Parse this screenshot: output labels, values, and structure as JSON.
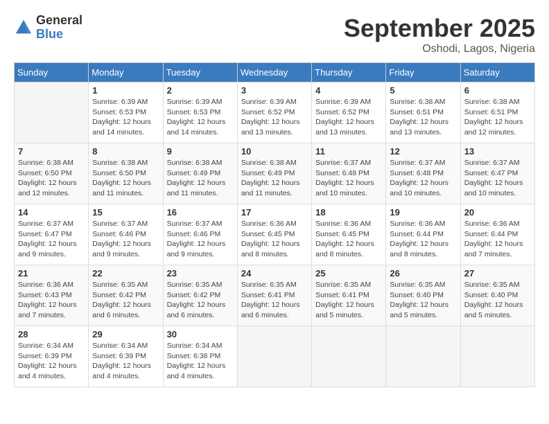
{
  "logo": {
    "general": "General",
    "blue": "Blue"
  },
  "title": "September 2025",
  "location": "Oshodi, Lagos, Nigeria",
  "days_of_week": [
    "Sunday",
    "Monday",
    "Tuesday",
    "Wednesday",
    "Thursday",
    "Friday",
    "Saturday"
  ],
  "weeks": [
    [
      {
        "day": "",
        "info": ""
      },
      {
        "day": "1",
        "info": "Sunrise: 6:39 AM\nSunset: 6:53 PM\nDaylight: 12 hours\nand 14 minutes."
      },
      {
        "day": "2",
        "info": "Sunrise: 6:39 AM\nSunset: 6:53 PM\nDaylight: 12 hours\nand 14 minutes."
      },
      {
        "day": "3",
        "info": "Sunrise: 6:39 AM\nSunset: 6:52 PM\nDaylight: 12 hours\nand 13 minutes."
      },
      {
        "day": "4",
        "info": "Sunrise: 6:39 AM\nSunset: 6:52 PM\nDaylight: 12 hours\nand 13 minutes."
      },
      {
        "day": "5",
        "info": "Sunrise: 6:38 AM\nSunset: 6:51 PM\nDaylight: 12 hours\nand 13 minutes."
      },
      {
        "day": "6",
        "info": "Sunrise: 6:38 AM\nSunset: 6:51 PM\nDaylight: 12 hours\nand 12 minutes."
      }
    ],
    [
      {
        "day": "7",
        "info": "Sunrise: 6:38 AM\nSunset: 6:50 PM\nDaylight: 12 hours\nand 12 minutes."
      },
      {
        "day": "8",
        "info": "Sunrise: 6:38 AM\nSunset: 6:50 PM\nDaylight: 12 hours\nand 11 minutes."
      },
      {
        "day": "9",
        "info": "Sunrise: 6:38 AM\nSunset: 6:49 PM\nDaylight: 12 hours\nand 11 minutes."
      },
      {
        "day": "10",
        "info": "Sunrise: 6:38 AM\nSunset: 6:49 PM\nDaylight: 12 hours\nand 11 minutes."
      },
      {
        "day": "11",
        "info": "Sunrise: 6:37 AM\nSunset: 6:48 PM\nDaylight: 12 hours\nand 10 minutes."
      },
      {
        "day": "12",
        "info": "Sunrise: 6:37 AM\nSunset: 6:48 PM\nDaylight: 12 hours\nand 10 minutes."
      },
      {
        "day": "13",
        "info": "Sunrise: 6:37 AM\nSunset: 6:47 PM\nDaylight: 12 hours\nand 10 minutes."
      }
    ],
    [
      {
        "day": "14",
        "info": "Sunrise: 6:37 AM\nSunset: 6:47 PM\nDaylight: 12 hours\nand 9 minutes."
      },
      {
        "day": "15",
        "info": "Sunrise: 6:37 AM\nSunset: 6:46 PM\nDaylight: 12 hours\nand 9 minutes."
      },
      {
        "day": "16",
        "info": "Sunrise: 6:37 AM\nSunset: 6:46 PM\nDaylight: 12 hours\nand 9 minutes."
      },
      {
        "day": "17",
        "info": "Sunrise: 6:36 AM\nSunset: 6:45 PM\nDaylight: 12 hours\nand 8 minutes."
      },
      {
        "day": "18",
        "info": "Sunrise: 6:36 AM\nSunset: 6:45 PM\nDaylight: 12 hours\nand 8 minutes."
      },
      {
        "day": "19",
        "info": "Sunrise: 6:36 AM\nSunset: 6:44 PM\nDaylight: 12 hours\nand 8 minutes."
      },
      {
        "day": "20",
        "info": "Sunrise: 6:36 AM\nSunset: 6:44 PM\nDaylight: 12 hours\nand 7 minutes."
      }
    ],
    [
      {
        "day": "21",
        "info": "Sunrise: 6:36 AM\nSunset: 6:43 PM\nDaylight: 12 hours\nand 7 minutes."
      },
      {
        "day": "22",
        "info": "Sunrise: 6:35 AM\nSunset: 6:42 PM\nDaylight: 12 hours\nand 6 minutes."
      },
      {
        "day": "23",
        "info": "Sunrise: 6:35 AM\nSunset: 6:42 PM\nDaylight: 12 hours\nand 6 minutes."
      },
      {
        "day": "24",
        "info": "Sunrise: 6:35 AM\nSunset: 6:41 PM\nDaylight: 12 hours\nand 6 minutes."
      },
      {
        "day": "25",
        "info": "Sunrise: 6:35 AM\nSunset: 6:41 PM\nDaylight: 12 hours\nand 5 minutes."
      },
      {
        "day": "26",
        "info": "Sunrise: 6:35 AM\nSunset: 6:40 PM\nDaylight: 12 hours\nand 5 minutes."
      },
      {
        "day": "27",
        "info": "Sunrise: 6:35 AM\nSunset: 6:40 PM\nDaylight: 12 hours\nand 5 minutes."
      }
    ],
    [
      {
        "day": "28",
        "info": "Sunrise: 6:34 AM\nSunset: 6:39 PM\nDaylight: 12 hours\nand 4 minutes."
      },
      {
        "day": "29",
        "info": "Sunrise: 6:34 AM\nSunset: 6:39 PM\nDaylight: 12 hours\nand 4 minutes."
      },
      {
        "day": "30",
        "info": "Sunrise: 6:34 AM\nSunset: 6:38 PM\nDaylight: 12 hours\nand 4 minutes."
      },
      {
        "day": "",
        "info": ""
      },
      {
        "day": "",
        "info": ""
      },
      {
        "day": "",
        "info": ""
      },
      {
        "day": "",
        "info": ""
      }
    ]
  ]
}
